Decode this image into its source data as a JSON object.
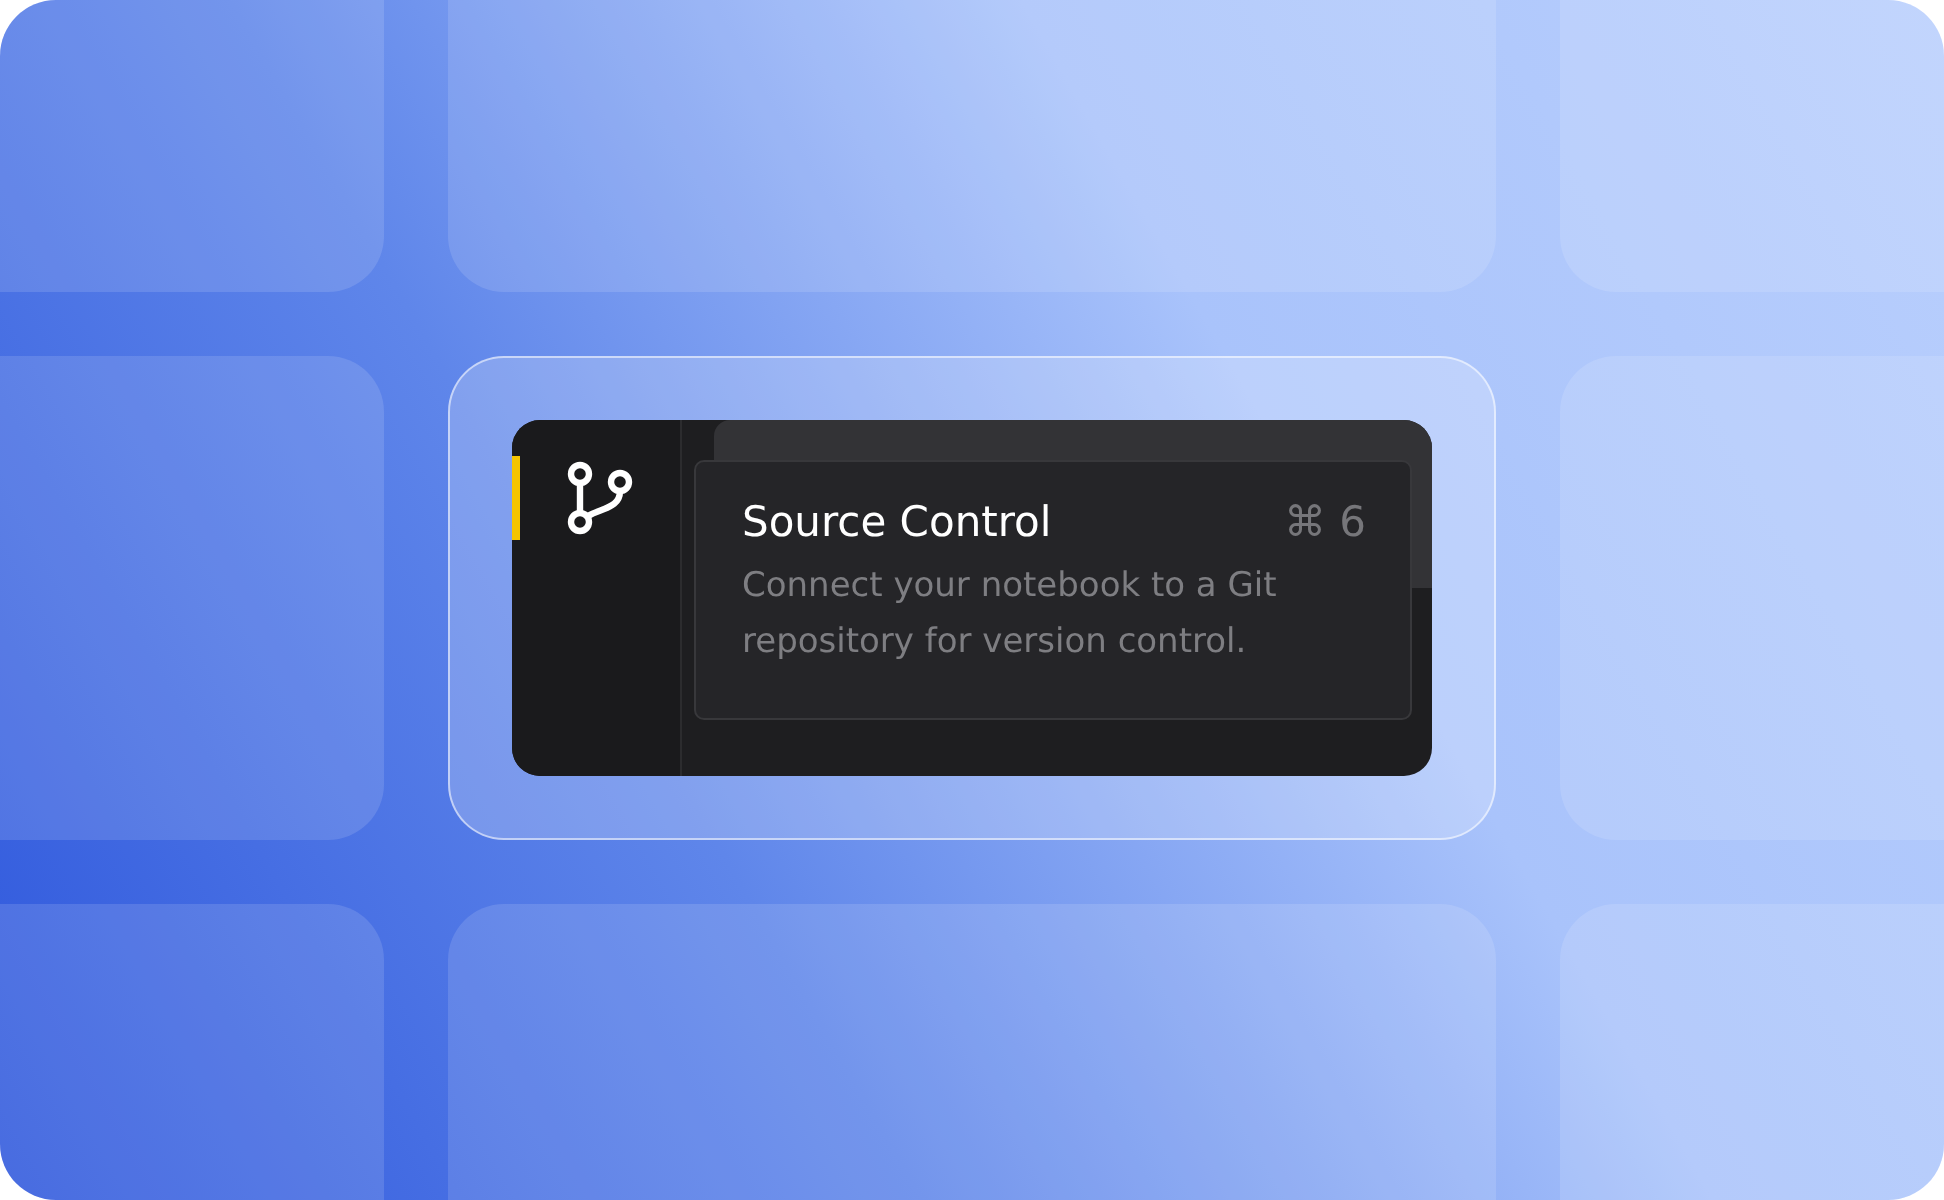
{
  "activity_bar": {
    "items": [
      {
        "selected": true
      }
    ]
  },
  "tooltip": {
    "title": "Source Control",
    "shortcut": "⌘ 6",
    "description": "Connect your notebook to a Git repository for version control."
  }
}
